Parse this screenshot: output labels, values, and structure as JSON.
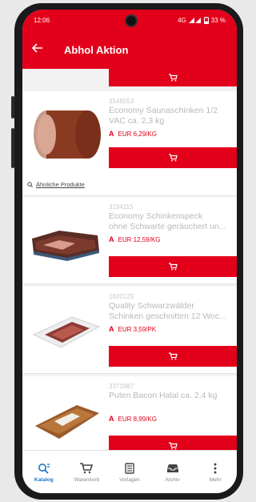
{
  "status": {
    "time": "12:06",
    "network": "4G",
    "battery": "33 %"
  },
  "appbar": {
    "title": "Abhol Aktion"
  },
  "products": [
    {
      "sku": "3546553",
      "name_line1": "Economy Saunaschinken 1/2",
      "name_line2": "VAC ca. 2,3 kg",
      "price": "EUR 6,29/KG"
    },
    {
      "sku": "3194115",
      "name_line1": "Economy Schinkenspeck",
      "name_line2": "ohne Schwarte geräuchert un...",
      "price": "EUR 12,59/KG"
    },
    {
      "sku": "1820125",
      "name_line1": "Quality Schwarzwälder",
      "name_line2": "Schinken geschnitten 12 Woc...",
      "price": "EUR 3,59/PK"
    },
    {
      "sku": "3371887",
      "name_line1": "Puten Bacon Halal ca. 2,4 kg",
      "name_line2": "",
      "price": "EUR 8,99/KG"
    }
  ],
  "similar_link": "Ähnliche Produkte",
  "nav": [
    {
      "label": "Katalog",
      "icon": "catalog-search-icon"
    },
    {
      "label": "Warenkorb",
      "icon": "cart-icon"
    },
    {
      "label": "Vorlagen",
      "icon": "template-icon"
    },
    {
      "label": "Archiv",
      "icon": "archive-icon"
    },
    {
      "label": "Mehr",
      "icon": "more-icon"
    }
  ],
  "colors": {
    "brand_red": "#e3001b",
    "active_blue": "#1a73c8"
  }
}
